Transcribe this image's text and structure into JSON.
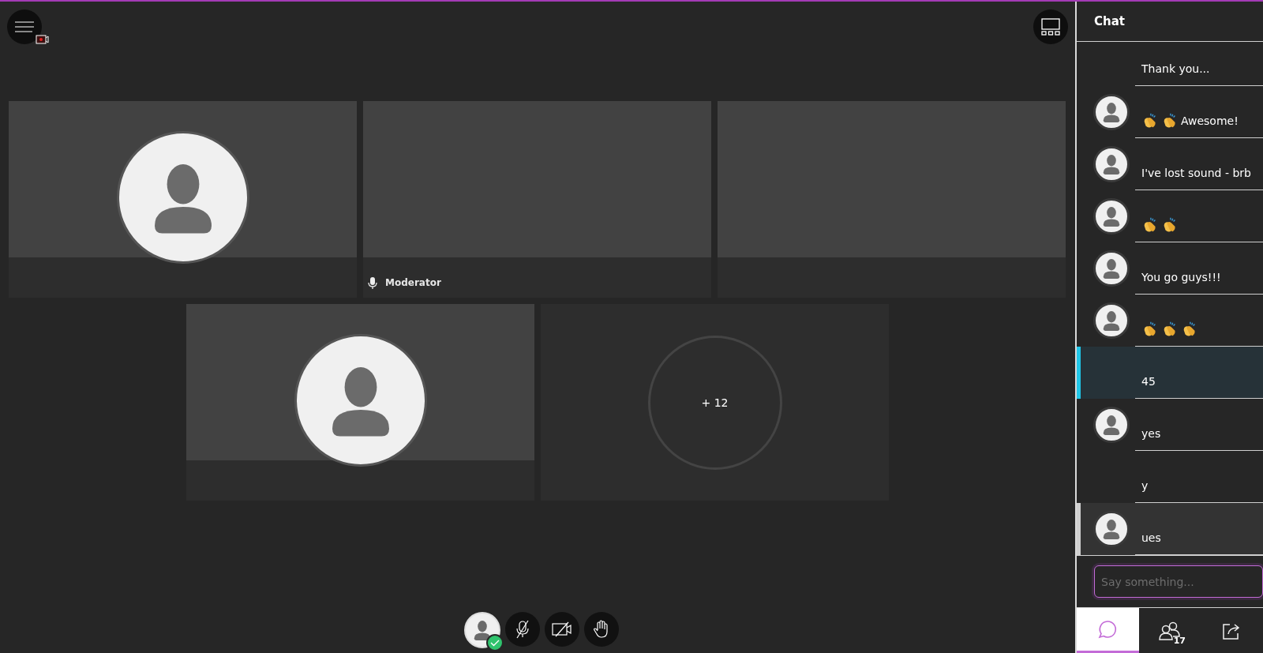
{
  "top_bar": {
    "recording": true
  },
  "tiles": [
    {
      "kind": "avatar"
    },
    {
      "kind": "blank",
      "label": "Moderator",
      "mic": true
    },
    {
      "kind": "blank"
    },
    {
      "kind": "avatar"
    },
    {
      "kind": "overflow",
      "count": "+ 12"
    }
  ],
  "controls": {
    "status_ok": true,
    "muted": true,
    "camera_off": true
  },
  "chat": {
    "title": "Chat",
    "messages": [
      {
        "avatar": false,
        "selected": false,
        "hovered": false,
        "parts": [
          {
            "kind": "text",
            "text": "Thank you..."
          }
        ]
      },
      {
        "avatar": true,
        "selected": false,
        "hovered": false,
        "parts": [
          {
            "kind": "clap"
          },
          {
            "kind": "clap"
          },
          {
            "kind": "text",
            "text": "Awesome!"
          }
        ]
      },
      {
        "avatar": true,
        "selected": false,
        "hovered": false,
        "parts": [
          {
            "kind": "text",
            "text": "I've lost sound - brb"
          }
        ]
      },
      {
        "avatar": true,
        "selected": false,
        "hovered": false,
        "parts": [
          {
            "kind": "clap"
          },
          {
            "kind": "clap"
          }
        ]
      },
      {
        "avatar": true,
        "selected": false,
        "hovered": false,
        "parts": [
          {
            "kind": "text",
            "text": "You go guys!!!"
          }
        ]
      },
      {
        "avatar": true,
        "selected": false,
        "hovered": false,
        "parts": [
          {
            "kind": "clap"
          },
          {
            "kind": "clap"
          },
          {
            "kind": "clap"
          }
        ]
      },
      {
        "avatar": false,
        "selected": true,
        "hovered": false,
        "parts": [
          {
            "kind": "text",
            "text": "45"
          }
        ]
      },
      {
        "avatar": true,
        "selected": false,
        "hovered": false,
        "parts": [
          {
            "kind": "text",
            "text": "yes"
          }
        ]
      },
      {
        "avatar": false,
        "selected": false,
        "hovered": false,
        "parts": [
          {
            "kind": "text",
            "text": "y"
          }
        ]
      },
      {
        "avatar": true,
        "selected": false,
        "hovered": true,
        "parts": [
          {
            "kind": "text",
            "text": "ues"
          }
        ]
      }
    ],
    "input": {
      "placeholder": "Say something..."
    },
    "tabs": [
      {
        "kind": "chat",
        "selected": true
      },
      {
        "kind": "people",
        "selected": false,
        "badge": "17"
      },
      {
        "kind": "share",
        "selected": false
      }
    ]
  }
}
